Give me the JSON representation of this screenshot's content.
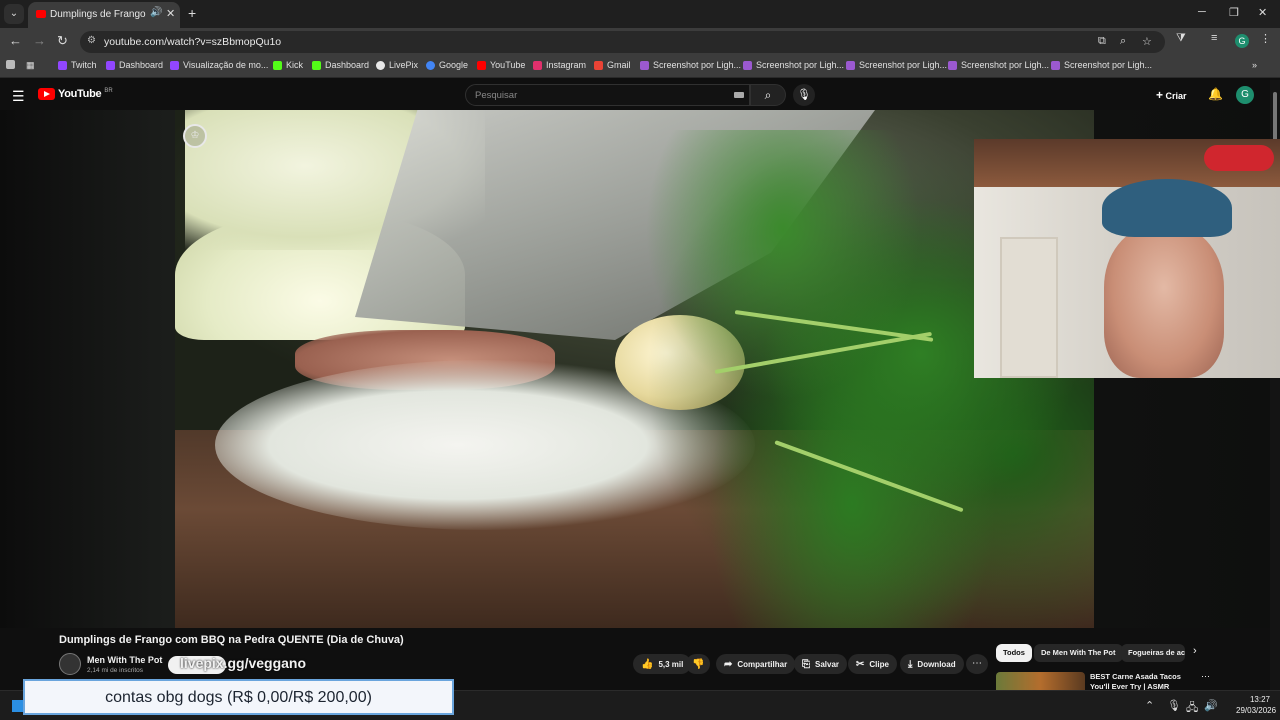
{
  "browser": {
    "tab_title": "Dumplings de Frango com BBQ na Pedra QUENTE (Dia de Chuva) - YouTube",
    "url": "youtube.com/watch?v=szBbmopQu1o",
    "profile_initial": "G",
    "bookmarks": [
      {
        "label": "Twitch",
        "color": "#9146ff"
      },
      {
        "label": "Dashboard",
        "color": "#9146ff"
      },
      {
        "label": "Visualização de mo...",
        "color": "#9146ff"
      },
      {
        "label": "Kick",
        "color": "#53fc18"
      },
      {
        "label": "Dashboard",
        "color": "#53fc18"
      },
      {
        "label": "LivePix",
        "color": "#e8e8e8"
      },
      {
        "label": "Google",
        "color": "#4285f4"
      },
      {
        "label": "YouTube",
        "color": "#ff0000"
      },
      {
        "label": "Instagram",
        "color": "#e1306c"
      },
      {
        "label": "Gmail",
        "color": "#ea4335"
      },
      {
        "label": "Screenshot por Ligh...",
        "color": "#9b59d0"
      },
      {
        "label": "Screenshot por Ligh...",
        "color": "#9b59d0"
      },
      {
        "label": "Screenshot por Ligh...",
        "color": "#9b59d0"
      },
      {
        "label": "Screenshot por Ligh...",
        "color": "#9b59d0"
      },
      {
        "label": "Screenshot por Ligh...",
        "color": "#9b59d0"
      }
    ]
  },
  "youtube": {
    "logo_text": "YouTube",
    "country_code": "BR",
    "search_placeholder": "Pesquisar",
    "create_label": "Criar",
    "avatar_initial": "G"
  },
  "video": {
    "title": "Dumplings de Frango com BBQ na Pedra QUENTE (Dia de Chuva)",
    "channel_name": "Men With The Pot",
    "channel_subs": "2,14 mi de inscritos",
    "subscribe_label": "Inscrever-se",
    "overlay_command": "livepix.gg/veggano",
    "likes": "5,3 mil",
    "share_label": "Compartilhar",
    "save_label": "Salvar",
    "clip_label": "Clipe",
    "download_label": "Download"
  },
  "sidebar": {
    "chips": [
      "Todos",
      "De Men With The Pot",
      "Fogueiras de acampamento"
    ],
    "rec_title": "BEST Carne Asada Tacos You'll Ever Try | ASMR Outdoor Fire"
  },
  "overlay_banner": "contas obg dogs (R$ 0,00/R$ 200,00)",
  "taskbar": {
    "time": "13:27",
    "date": "29/03/2026"
  }
}
